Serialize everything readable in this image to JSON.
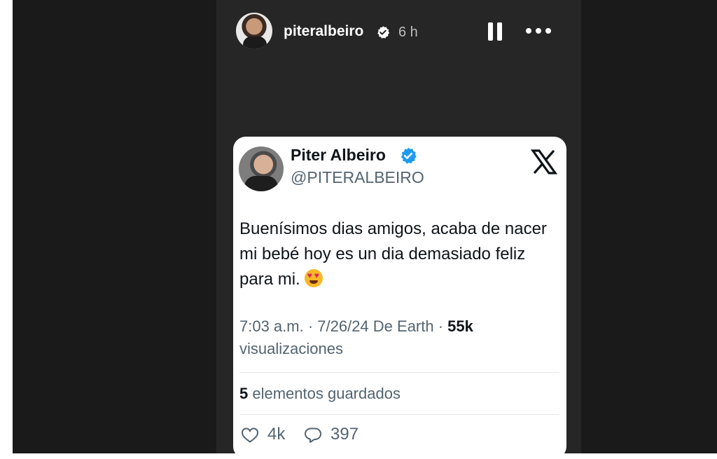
{
  "story": {
    "username": "piteralbeiro",
    "time_ago": "6 h"
  },
  "tweet": {
    "display_name": "Piter Albeiro",
    "handle": "@PITERALBEIRO",
    "text": "Buenísimos dias amigos, acaba de nacer mi bebé hoy es un dia demasiado feliz para mi.",
    "emoji": "😍",
    "meta": {
      "prefix": "7:03 a.m. · 7/26/24 De Earth · ",
      "views_count": "55k",
      "views_label": " visualizaciones"
    },
    "saved": {
      "count": "5",
      "label": " elementos guardados"
    },
    "actions": {
      "likes": "4k",
      "replies": "397"
    }
  },
  "icons": {
    "verified": "verified-badge-icon",
    "x_logo": "x-logo-icon",
    "pause": "pause-icon",
    "more": "more-icon",
    "heart": "heart-icon",
    "reply": "comment-icon"
  },
  "colors": {
    "story_bg": "#262626",
    "outer_bg": "#1a1a1a",
    "card_bg": "#ffffff",
    "verified_blue": "#1d9bf0",
    "muted_text": "#536471"
  }
}
